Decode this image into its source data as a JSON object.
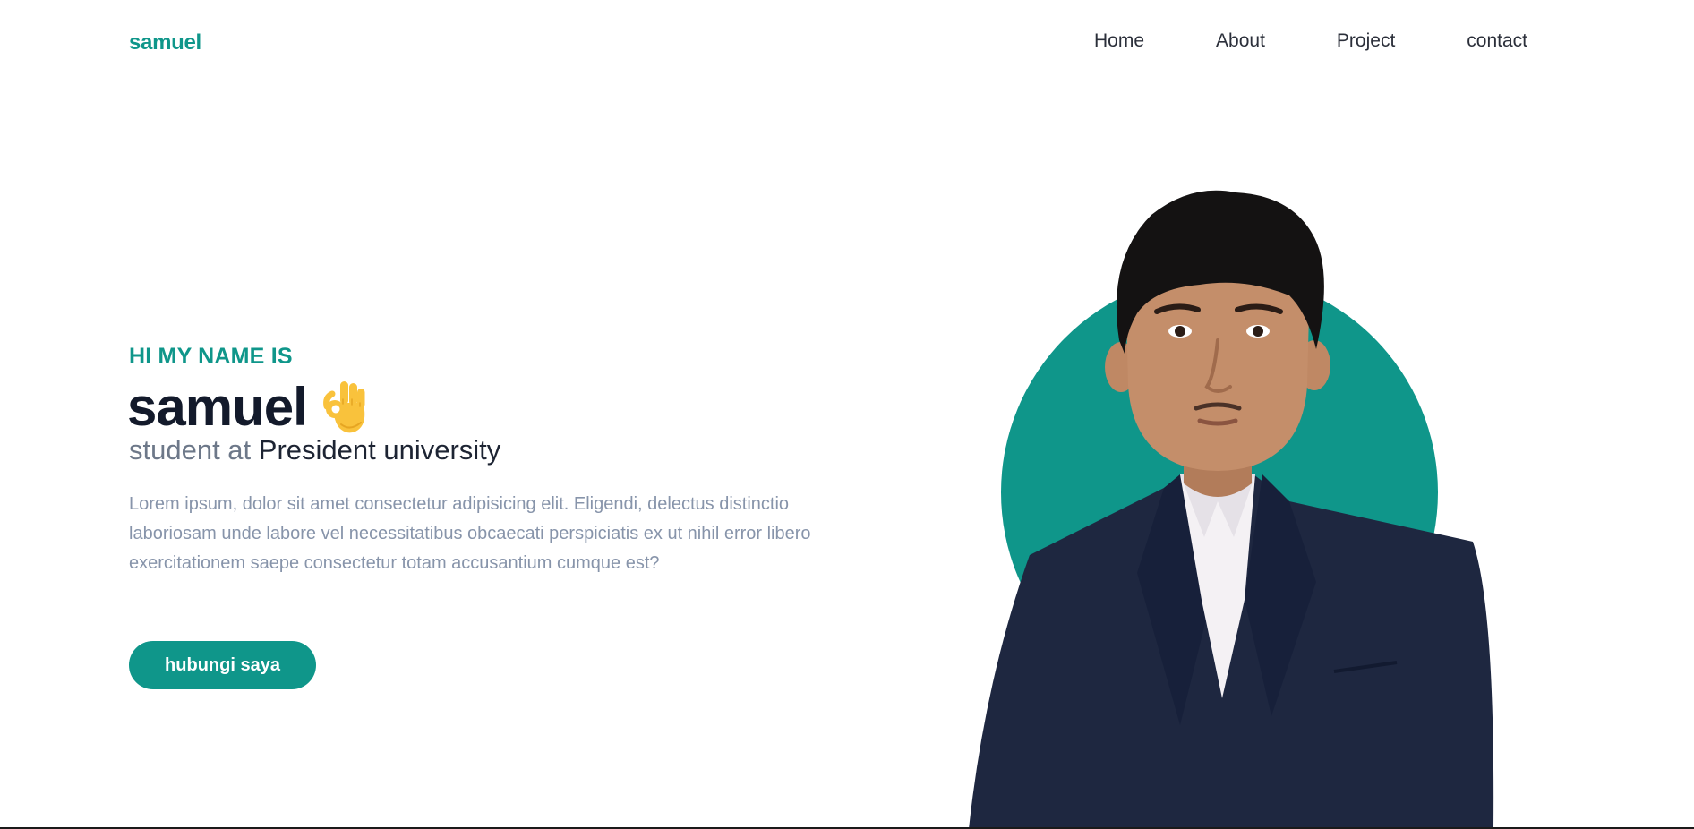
{
  "nav": {
    "brand": "samuel",
    "links": [
      {
        "label": "Home"
      },
      {
        "label": "About"
      },
      {
        "label": "Project"
      },
      {
        "label": "contact"
      }
    ]
  },
  "hero": {
    "greeting": "HI MY NAME IS",
    "name": "samuel",
    "emoji_icon": "ok-hand-icon",
    "subtitle_prefix": "student at",
    "subtitle_highlight": "President university",
    "description": "Lorem ipsum, dolor sit amet consectetur adipisicing elit. Eligendi, delectus distinctio laboriosam unde labore vel necessitatibus obcaecati perspiciatis ex ut nihil error libero exercitationem saepe consectetur totam accusantium cumque est?",
    "cta_label": "hubungi saya"
  },
  "colors": {
    "accent": "#0f968a",
    "heading": "#131a2b",
    "muted": "#8794aa",
    "suit": "#1e2740",
    "skin": "#c48e6a"
  }
}
